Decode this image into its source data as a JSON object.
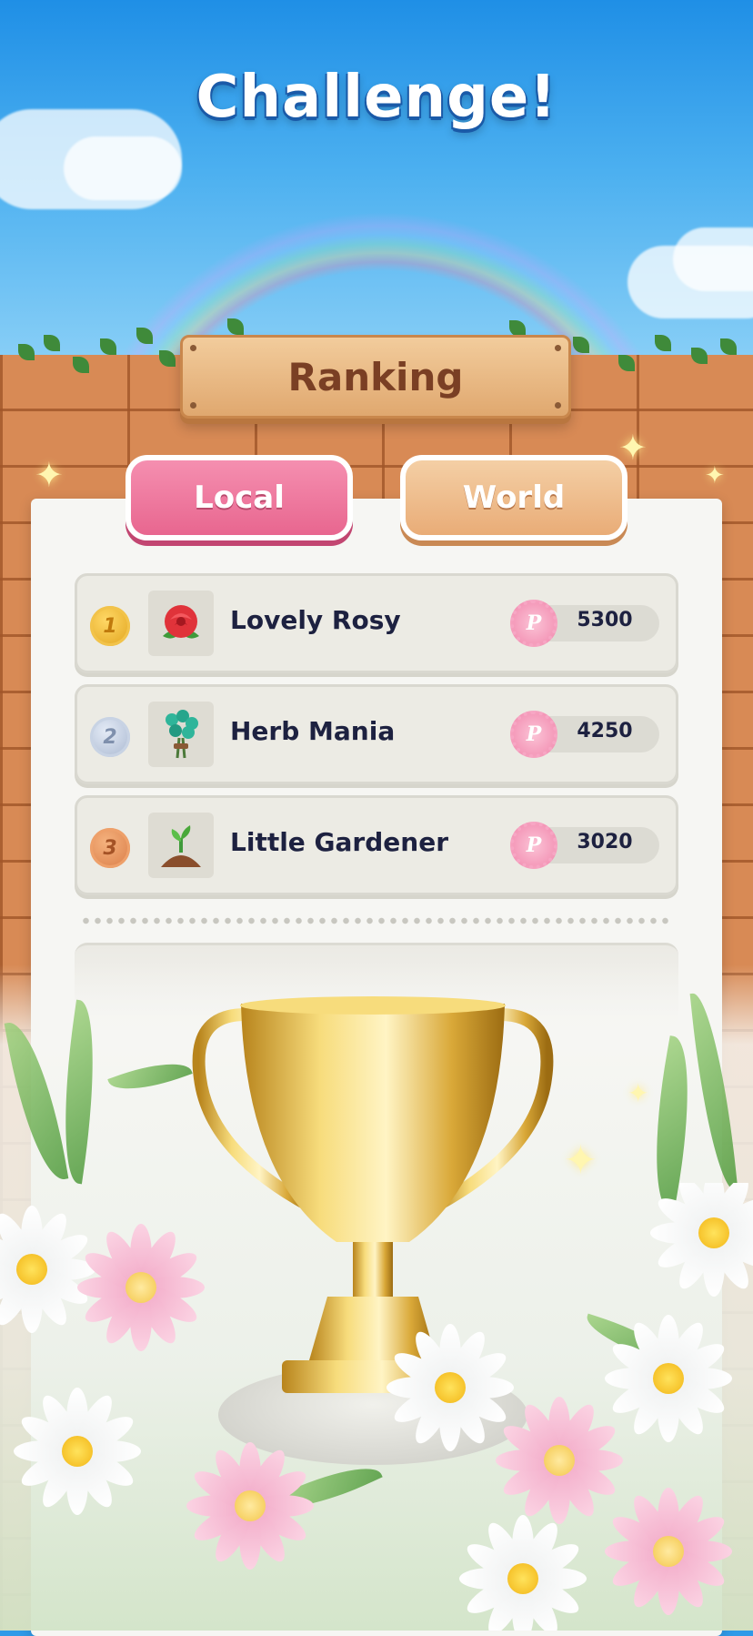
{
  "title": "Challenge!",
  "header_sign": "Ranking",
  "tabs": [
    {
      "label": "Local",
      "active": true
    },
    {
      "label": "World",
      "active": false
    }
  ],
  "rankings": [
    {
      "rank": "1",
      "name": "Lovely Rosy",
      "icon": "rose-icon",
      "score": "5300",
      "badge": "P"
    },
    {
      "rank": "2",
      "name": "Herb Mania",
      "icon": "herb-icon",
      "score": "4250",
      "badge": "P"
    },
    {
      "rank": "3",
      "name": "Little Gardener",
      "icon": "sprout-icon",
      "score": "3020",
      "badge": "P"
    }
  ],
  "colors": {
    "sky": "#1f8fe6",
    "brick": "#d88a55",
    "local_tab": "#e8668f",
    "world_tab": "#e9ac77",
    "text_dark": "#1d2140",
    "sign_text": "#7a3f24"
  }
}
